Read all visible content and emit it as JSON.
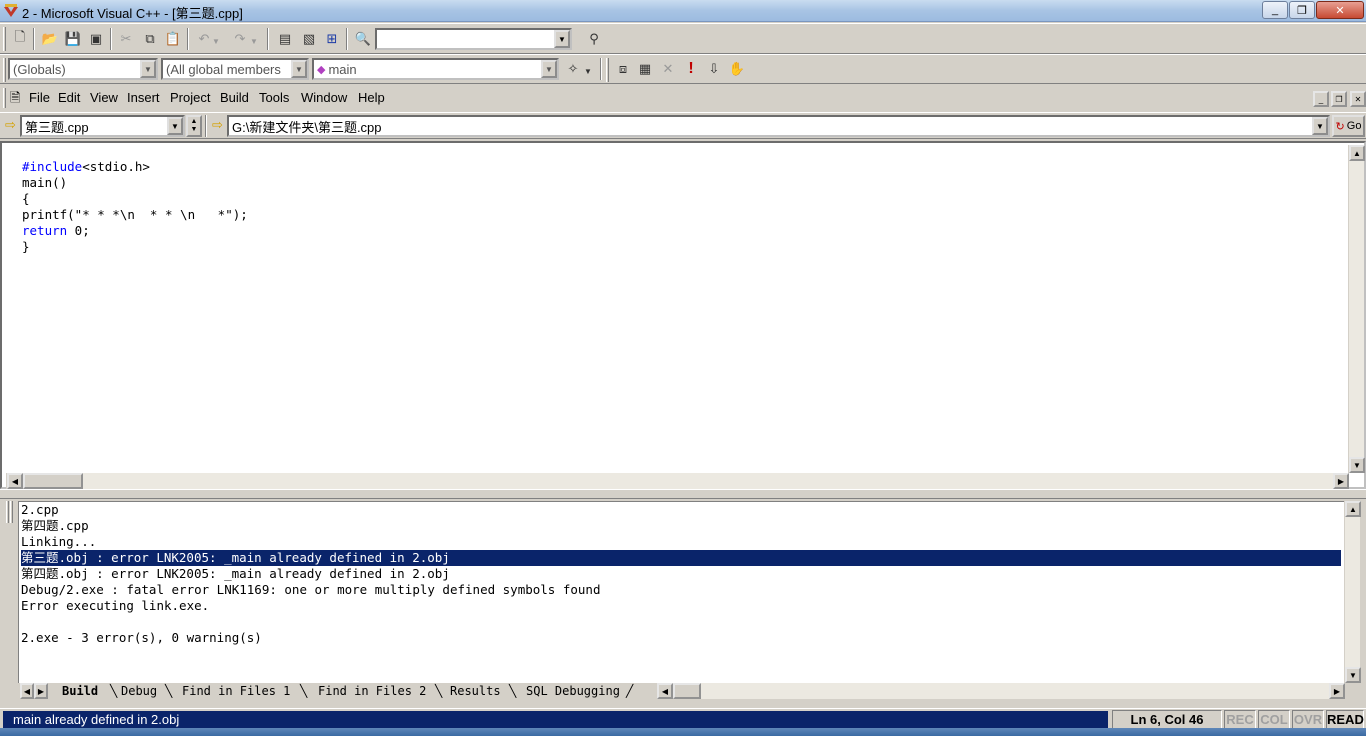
{
  "window": {
    "title": "2 - Microsoft Visual C++ - [第三题.cpp]",
    "minimize": "_",
    "maximize": "❐",
    "close": "✕"
  },
  "toolbar2": {
    "scope_combo": "(Globals)",
    "members_combo": "(All global members",
    "function_combo": "main"
  },
  "menu": {
    "items": [
      "File",
      "Edit",
      "View",
      "Insert",
      "Project",
      "Build",
      "Tools",
      "Window",
      "Help"
    ]
  },
  "pathbar": {
    "file_combo": "第三题.cpp",
    "path_combo": "G:\\新建文件夹\\第三题.cpp",
    "go_label": "Go"
  },
  "editor": {
    "lines": [
      [
        "#include",
        "<stdio.h>"
      ],
      [
        "main()",
        ""
      ],
      [
        "{",
        ""
      ],
      [
        "printf(\"* * *\\n  * * \\n   *\");",
        ""
      ],
      [
        "return",
        " 0;"
      ],
      [
        "}",
        ""
      ]
    ]
  },
  "output": {
    "lines": [
      "2.cpp",
      "第四题.cpp",
      "Linking...",
      "第三题.obj : error LNK2005: _main already defined in 2.obj",
      "第四题.obj : error LNK2005: _main already defined in 2.obj",
      "Debug/2.exe : fatal error LNK1169: one or more multiply defined symbols found",
      "Error executing link.exe.",
      "",
      "2.exe - 3 error(s), 0 warning(s)"
    ],
    "selected_index": 3,
    "tabs": [
      "Build",
      "Debug",
      "Find in Files 1",
      "Find in Files 2",
      "Results",
      "SQL Debugging"
    ]
  },
  "status": {
    "message": "main already defined in 2.obj",
    "position": "Ln 6, Col 46",
    "rec": "REC",
    "col": "COL",
    "ovr": "OVR",
    "read": "READ"
  },
  "colors": {
    "selection": "#0a246a",
    "keyword": "#0000ff",
    "chrome": "#d4d0c8"
  }
}
